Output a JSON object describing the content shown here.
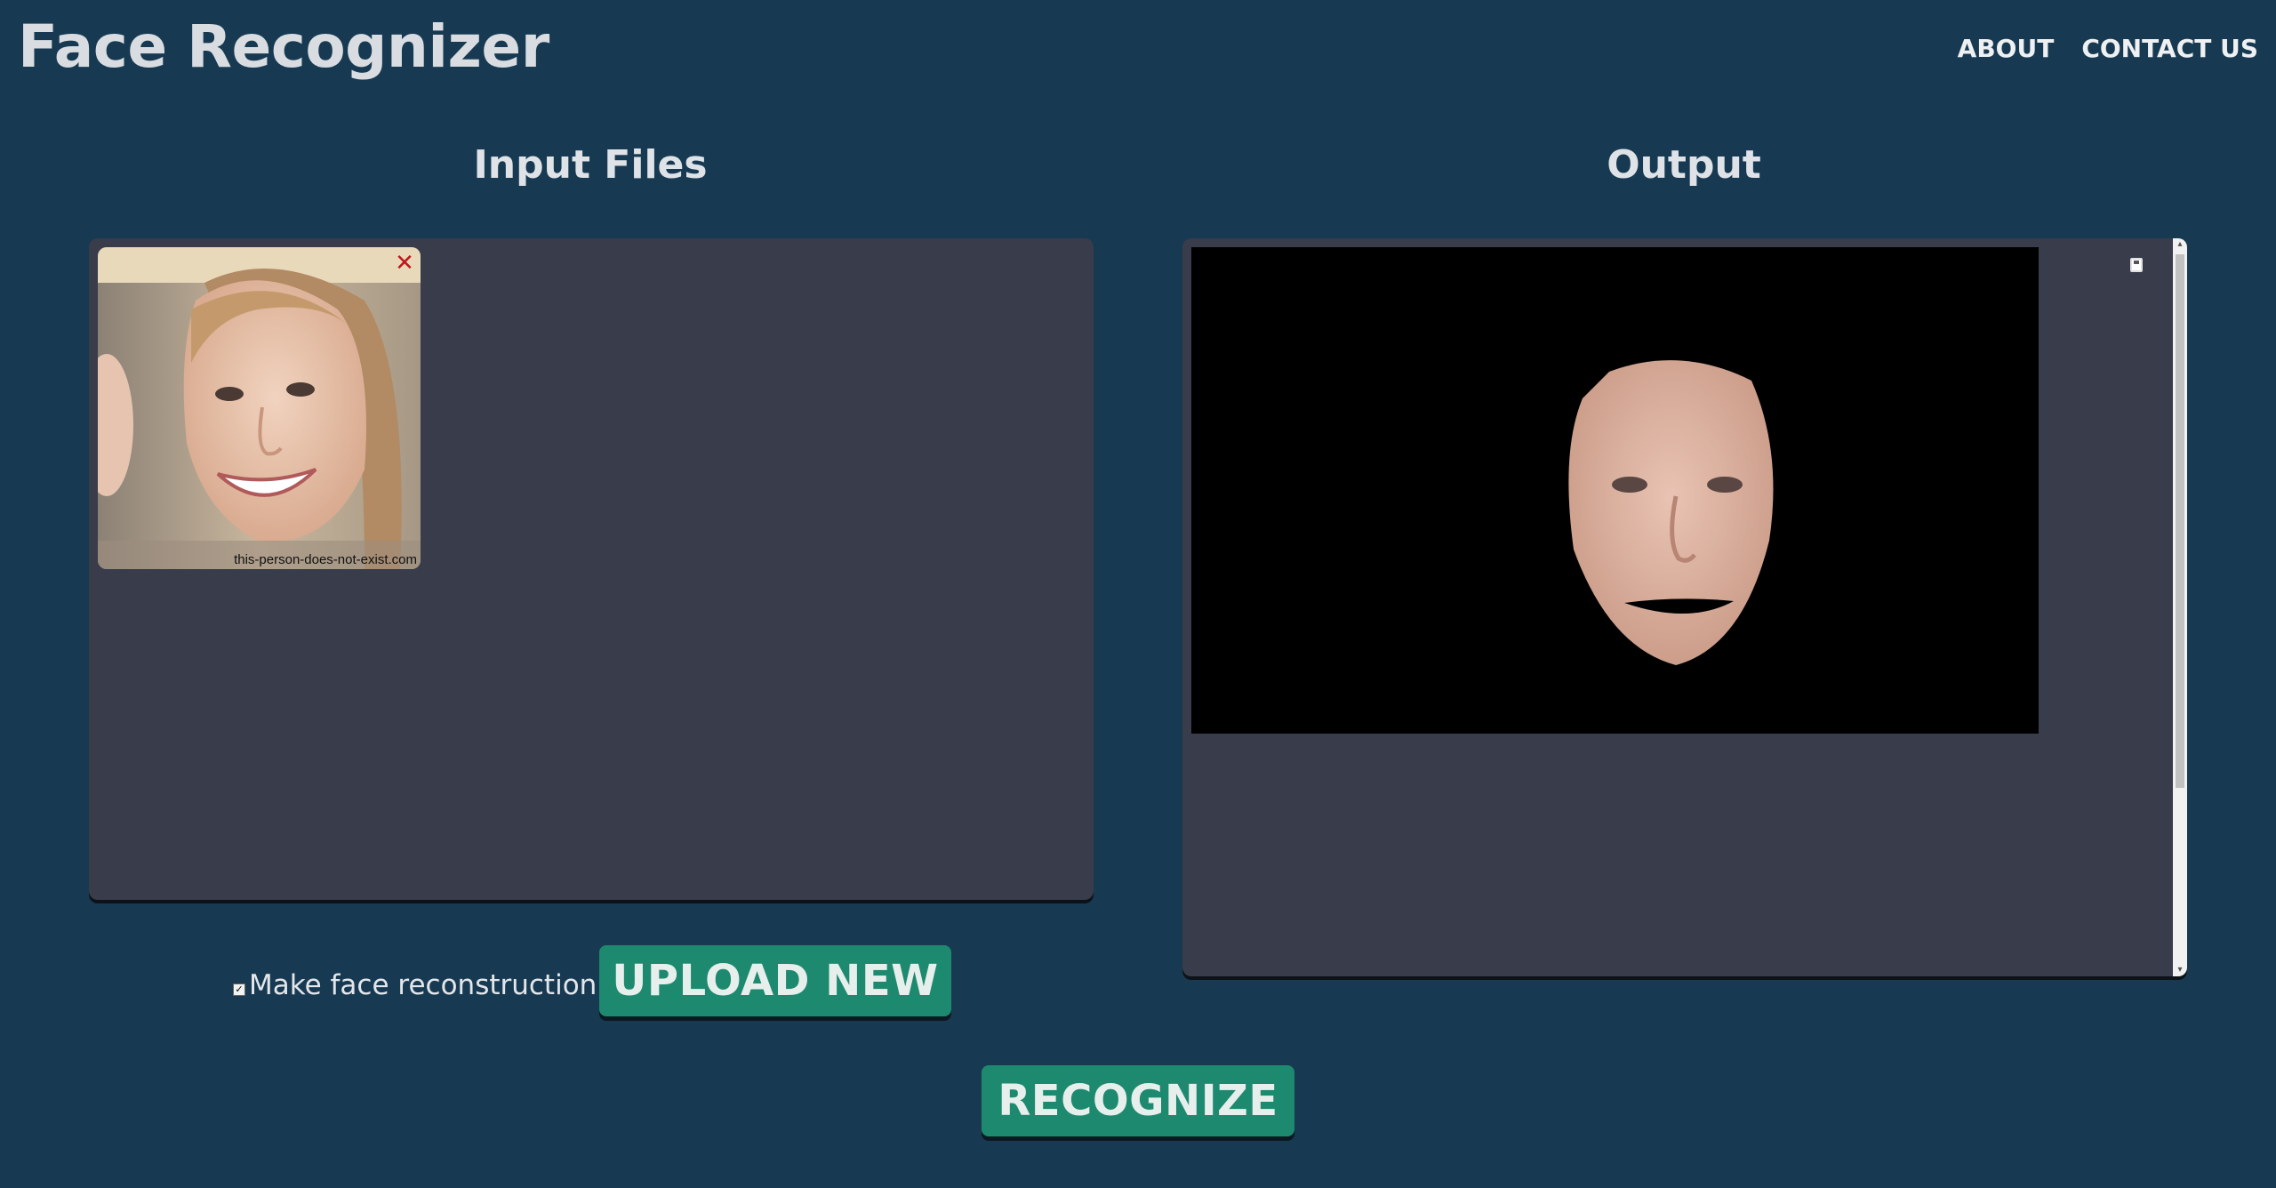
{
  "header": {
    "title": "Face Recognizer",
    "nav": [
      {
        "label": "ABOUT"
      },
      {
        "label": "CONTACT US"
      }
    ]
  },
  "input_section": {
    "title": "Input Files",
    "files": [
      {
        "watermark": "this-person-does-not-exist.com"
      }
    ]
  },
  "output_section": {
    "title": "Output"
  },
  "controls": {
    "reconstruct_label": "Make face reconstruction",
    "reconstruct_checked": true,
    "upload_label": "UPLOAD NEW",
    "recognize_label": "RECOGNIZE"
  },
  "icons": {
    "remove": "close-icon",
    "save": "save-icon",
    "checkbox": "checkmark-icon"
  },
  "colors": {
    "background": "#173a52",
    "panel": "#393c4a",
    "button": "#1d8a70"
  }
}
